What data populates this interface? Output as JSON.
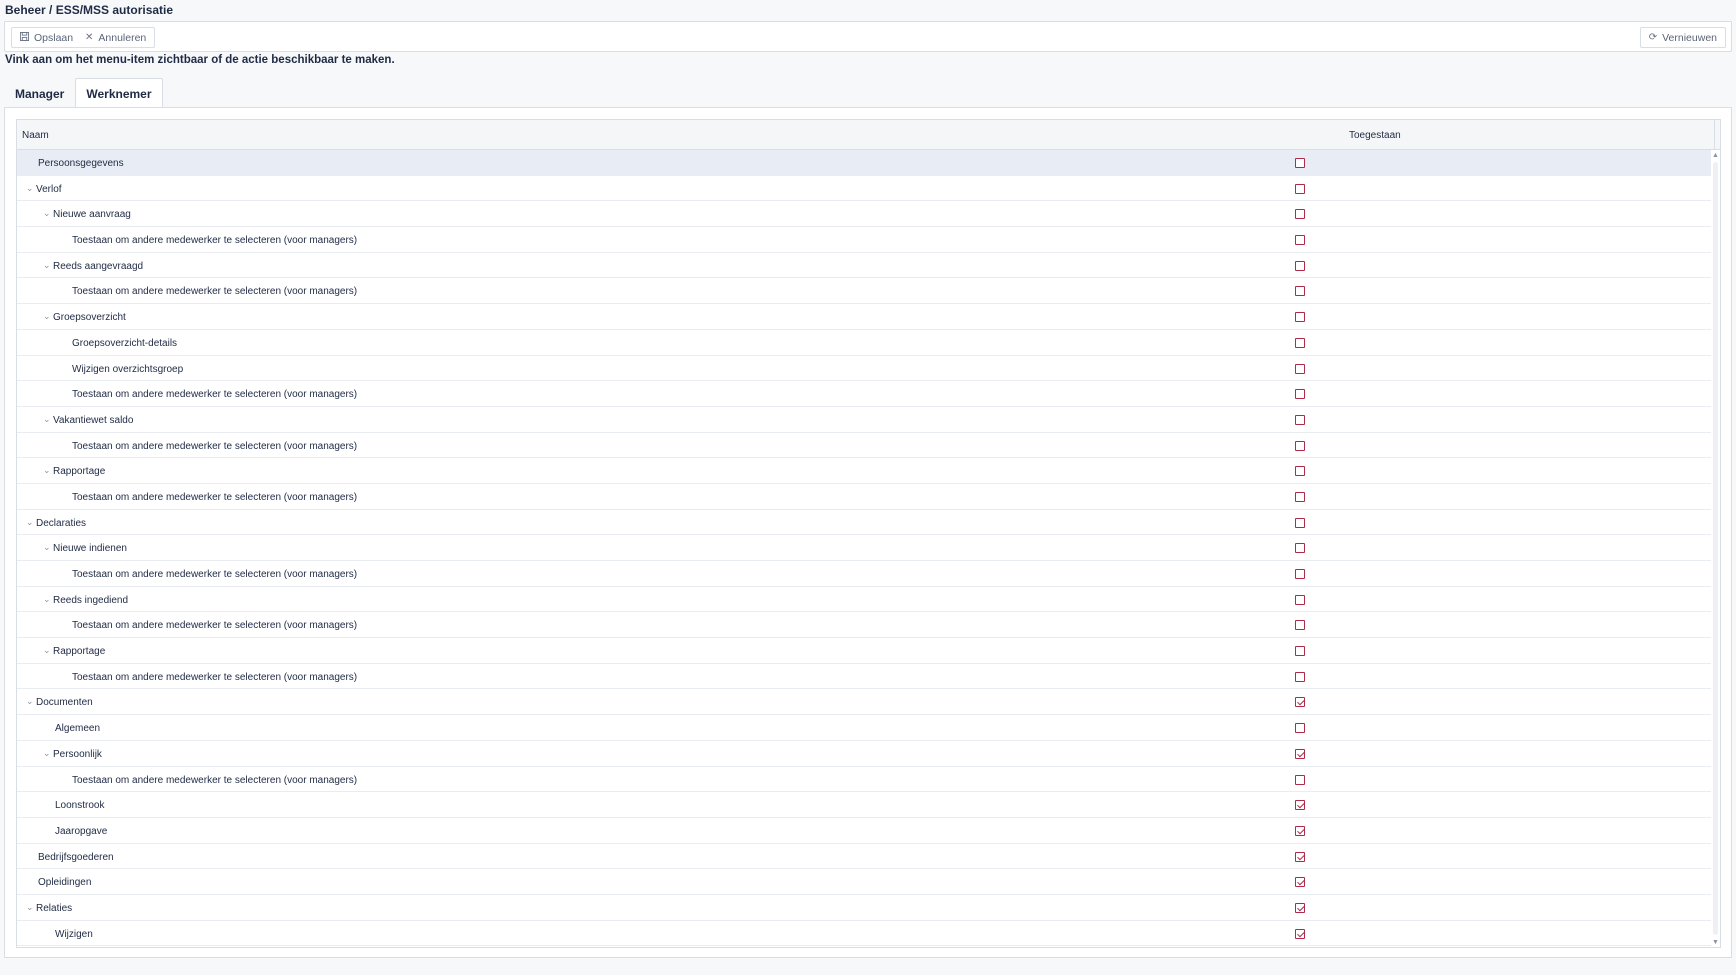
{
  "page_title": "Beheer / ESS/MSS autorisatie",
  "toolbar": {
    "save_label": "Opslaan",
    "cancel_label": "Annuleren",
    "refresh_label": "Vernieuwen",
    "save_icon": "floppy-disk-icon",
    "cancel_icon": "close-icon",
    "refresh_icon": "refresh-icon"
  },
  "instruction": "Vink aan om het menu-item zichtbaar of de actie beschikbaar te maken.",
  "tabs": [
    {
      "label": "Manager",
      "active": false
    },
    {
      "label": "Werknemer",
      "active": true
    }
  ],
  "grid": {
    "columns": [
      "Naam",
      "Toegestaan"
    ],
    "accent_color": "#b02a4a",
    "rows": [
      {
        "label": "Persoonsgegevens",
        "level": 0,
        "expandable": false,
        "checked": false,
        "selected": true
      },
      {
        "label": "Verlof",
        "level": 0,
        "expandable": true,
        "checked": false
      },
      {
        "label": "Nieuwe aanvraag",
        "level": 1,
        "expandable": true,
        "checked": false
      },
      {
        "label": "Toestaan om andere medewerker te selecteren (voor managers)",
        "level": 2,
        "expandable": false,
        "checked": false
      },
      {
        "label": "Reeds aangevraagd",
        "level": 1,
        "expandable": true,
        "checked": false
      },
      {
        "label": "Toestaan om andere medewerker te selecteren (voor managers)",
        "level": 2,
        "expandable": false,
        "checked": false
      },
      {
        "label": "Groepsoverzicht",
        "level": 1,
        "expandable": true,
        "checked": false
      },
      {
        "label": "Groepsoverzicht-details",
        "level": 2,
        "expandable": false,
        "checked": false
      },
      {
        "label": "Wijzigen overzichtsgroep",
        "level": 2,
        "expandable": false,
        "checked": false
      },
      {
        "label": "Toestaan om andere medewerker te selecteren (voor managers)",
        "level": 2,
        "expandable": false,
        "checked": false
      },
      {
        "label": "Vakantiewet saldo",
        "level": 1,
        "expandable": true,
        "checked": false
      },
      {
        "label": "Toestaan om andere medewerker te selecteren (voor managers)",
        "level": 2,
        "expandable": false,
        "checked": false
      },
      {
        "label": "Rapportage",
        "level": 1,
        "expandable": true,
        "checked": false
      },
      {
        "label": "Toestaan om andere medewerker te selecteren (voor managers)",
        "level": 2,
        "expandable": false,
        "checked": false
      },
      {
        "label": "Declaraties",
        "level": 0,
        "expandable": true,
        "checked": false
      },
      {
        "label": "Nieuwe indienen",
        "level": 1,
        "expandable": true,
        "checked": false
      },
      {
        "label": "Toestaan om andere medewerker te selecteren (voor managers)",
        "level": 2,
        "expandable": false,
        "checked": false
      },
      {
        "label": "Reeds ingediend",
        "level": 1,
        "expandable": true,
        "checked": false
      },
      {
        "label": "Toestaan om andere medewerker te selecteren (voor managers)",
        "level": 2,
        "expandable": false,
        "checked": false
      },
      {
        "label": "Rapportage",
        "level": 1,
        "expandable": true,
        "checked": false
      },
      {
        "label": "Toestaan om andere medewerker te selecteren (voor managers)",
        "level": 2,
        "expandable": false,
        "checked": false
      },
      {
        "label": "Documenten",
        "level": 0,
        "expandable": true,
        "checked": true
      },
      {
        "label": "Algemeen",
        "level": 1,
        "expandable": false,
        "checked": false
      },
      {
        "label": "Persoonlijk",
        "level": 1,
        "expandable": true,
        "checked": true
      },
      {
        "label": "Toestaan om andere medewerker te selecteren (voor managers)",
        "level": 2,
        "expandable": false,
        "checked": false
      },
      {
        "label": "Loonstrook",
        "level": 1,
        "expandable": false,
        "checked": true
      },
      {
        "label": "Jaaropgave",
        "level": 1,
        "expandable": false,
        "checked": true
      },
      {
        "label": "Bedrijfsgoederen",
        "level": 0,
        "expandable": false,
        "checked": true
      },
      {
        "label": "Opleidingen",
        "level": 0,
        "expandable": false,
        "checked": true
      },
      {
        "label": "Relaties",
        "level": 0,
        "expandable": true,
        "checked": true
      },
      {
        "label": "Wijzigen",
        "level": 1,
        "expandable": false,
        "checked": true
      }
    ]
  }
}
